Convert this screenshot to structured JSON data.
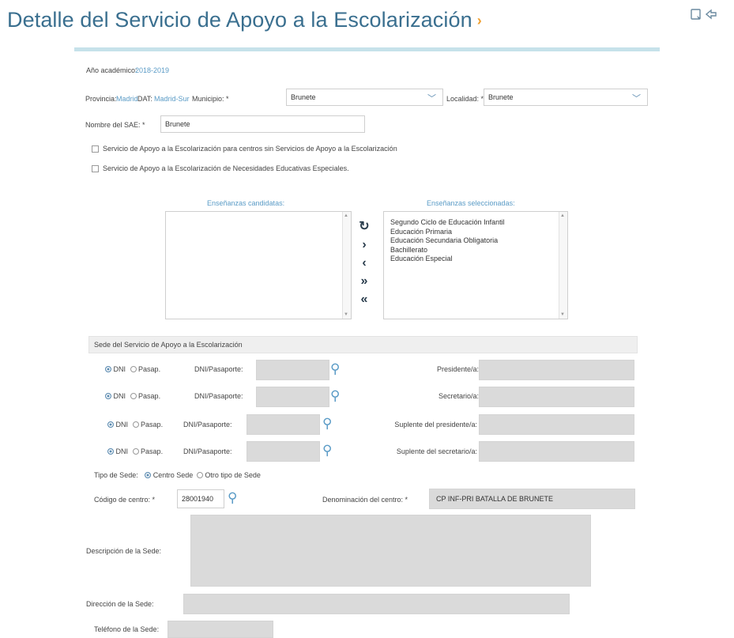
{
  "header": {
    "title": "Detalle del Servicio de Apoyo a la Escolarización",
    "chevron": "›",
    "icons": [
      "document-icon",
      "back-icon"
    ]
  },
  "form": {
    "anio": {
      "label": "Año académico:",
      "value": "2018-2019"
    },
    "provincia": {
      "label": "Provincia:",
      "value": "Madrid"
    },
    "dat": {
      "label": "DAT:",
      "value": "Madrid-Sur"
    },
    "municipio": {
      "label": "Municipio: *",
      "value": "Brunete"
    },
    "localidad": {
      "label": "Localidad: *",
      "value": "Brunete"
    },
    "nombre_sae": {
      "label": "Nombre del SAE: *",
      "value": "Brunete"
    },
    "check1": "Servicio de Apoyo a la Escolarización para centros sin Servicios de Apoyo a la Escolarización",
    "check2": "Servicio de Apoyo a la Escolarización de Necesidades Educativas Especiales.",
    "candidatas_title": "Enseñanzas candidatas:",
    "seleccionadas_title": "Enseñanzas seleccionadas:",
    "seleccionadas": [
      "Segundo Ciclo de Educación Infantil",
      "Educación Primaria",
      "Educación Secundaria Obligatoria",
      "Bachillerato",
      "Educación Especial"
    ],
    "controls": {
      "refresh": "↻",
      "move_right": "›",
      "move_left": "‹",
      "move_all_right": "»",
      "move_all_left": "«"
    }
  },
  "sede": {
    "section_title": "Sede del Servicio de Apoyo a la Escolarización",
    "rows": [
      {
        "dni": "DNI",
        "pasap": "Pasap.",
        "doc_label": "DNI/Pasaporte:",
        "role": "Presidente/a:"
      },
      {
        "dni": "DNI",
        "pasap": "Pasap.",
        "doc_label": "DNI/Pasaporte:",
        "role": "Secretario/a:"
      },
      {
        "dni": "DNI",
        "pasap": "Pasap.",
        "doc_label": "DNI/Pasaporte:",
        "role": "Suplente del presidente/a:"
      },
      {
        "dni": "DNI",
        "pasap": "Pasap.",
        "doc_label": "DNI/Pasaporte:",
        "role": "Suplente del secretario/a:"
      }
    ],
    "tipo_label": "Tipo de Sede:",
    "tipo_centro": "Centro Sede",
    "tipo_otro": "Otro tipo de Sede",
    "codigo_label": "Código de centro: *",
    "codigo_value": "28001940",
    "denominacion_label": "Denominación del centro: *",
    "denominacion_value": "CP INF-PRI BATALLA DE BRUNETE",
    "descripcion_label": "Descripción de la Sede:",
    "direccion_label": "Dirección de la Sede:",
    "telefono_label": "Teléfono de la Sede:"
  }
}
